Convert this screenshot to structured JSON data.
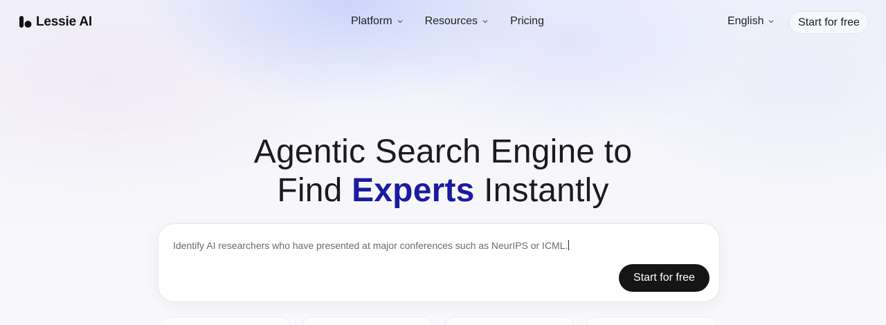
{
  "brand": {
    "name": "Lessie AI"
  },
  "nav": {
    "items": [
      {
        "label": "Platform",
        "has_dropdown": true
      },
      {
        "label": "Resources",
        "has_dropdown": true
      },
      {
        "label": "Pricing",
        "has_dropdown": false
      }
    ],
    "language": "English",
    "cta_label": "Start for free"
  },
  "hero": {
    "line1": "Agentic Search Engine to",
    "line2_pre": "Find ",
    "line2_accent": "Experts",
    "line2_post": " Instantly",
    "accent_color": "#1b1aa0"
  },
  "search": {
    "value": "Identify AI researchers who have presented at major conferences such as NeurIPS or ICML.",
    "button_label": "Start for free"
  },
  "icons": [
    "lessie-logo-icon",
    "chevron-down-icon"
  ]
}
